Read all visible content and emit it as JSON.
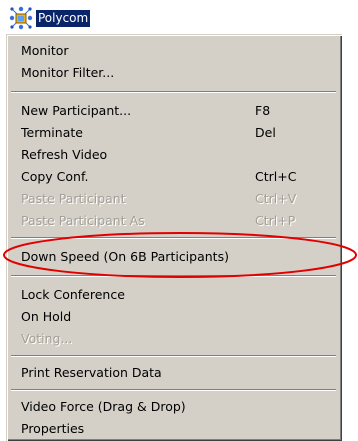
{
  "node": {
    "label": "Polycom",
    "icon": "conference-network-icon"
  },
  "menu": {
    "items": [
      {
        "label": "Monitor",
        "shortcut": "",
        "enabled": true
      },
      {
        "label": "Monitor Filter...",
        "shortcut": "",
        "enabled": true
      },
      {
        "label": "New Participant...",
        "shortcut": "F8",
        "enabled": true
      },
      {
        "label": "Terminate",
        "shortcut": "Del",
        "enabled": true
      },
      {
        "label": "Refresh Video",
        "shortcut": "",
        "enabled": true
      },
      {
        "label": "Copy Conf.",
        "shortcut": "Ctrl+C",
        "enabled": true
      },
      {
        "label": "Paste Participant",
        "shortcut": "Ctrl+V",
        "enabled": false
      },
      {
        "label": "Paste Participant As",
        "shortcut": "Ctrl+P",
        "enabled": false
      },
      {
        "label": "Down Speed (On 6B Participants)",
        "shortcut": "",
        "enabled": true
      },
      {
        "label": "Lock Conference",
        "shortcut": "",
        "enabled": true
      },
      {
        "label": "On Hold",
        "shortcut": "",
        "enabled": true
      },
      {
        "label": "Voting...",
        "shortcut": "",
        "enabled": false
      },
      {
        "label": "Print Reservation Data",
        "shortcut": "",
        "enabled": true
      },
      {
        "label": "Video Force (Drag & Drop)",
        "shortcut": "",
        "enabled": true
      },
      {
        "label": "Properties",
        "shortcut": "",
        "enabled": true
      }
    ]
  },
  "colors": {
    "menu_background": "#d4d0c8",
    "selection": "#0a246a",
    "annotation": "#e00000"
  }
}
